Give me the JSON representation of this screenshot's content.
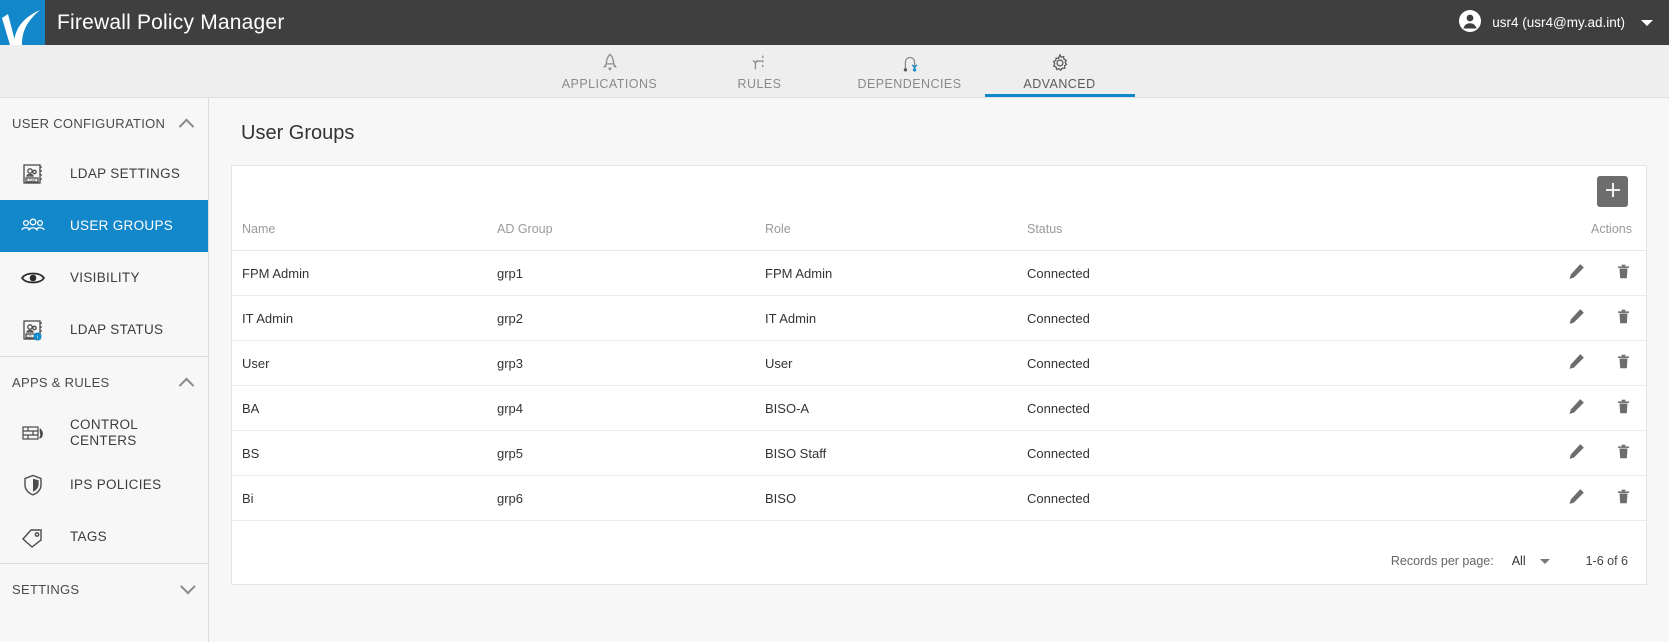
{
  "header": {
    "logo_icon": "brand-logo-icon",
    "app_title": "Firewall Policy Manager",
    "user_icon": "user-account-icon",
    "user_label": "usr4 (usr4@my.ad.int)",
    "user_menu_icon": "chevron-down-icon",
    "bg_color": "#3f3f3f",
    "logo_color": "#1288ca"
  },
  "tabs": [
    {
      "label": "APPLICATIONS",
      "icon": "rocket-icon",
      "active": false
    },
    {
      "label": "RULES",
      "icon": "rules-path-icon",
      "active": false
    },
    {
      "label": "DEPENDENCIES",
      "icon": "dependencies-arc-icon",
      "active": false
    },
    {
      "label": "ADVANCED",
      "icon": "gear-icon",
      "active": true
    }
  ],
  "accent_color": "#1288ca",
  "sidebar": {
    "sections": [
      {
        "label": "USER CONFIGURATION",
        "expanded": true,
        "chevron": "chevron-up-icon",
        "items": [
          {
            "label": "LDAP SETTINGS",
            "icon": "ldap-settings-icon",
            "active": false
          },
          {
            "label": "USER GROUPS",
            "icon": "user-groups-icon",
            "active": true
          },
          {
            "label": "VISIBILITY",
            "icon": "eye-icon",
            "active": false
          },
          {
            "label": "LDAP STATUS",
            "icon": "ldap-status-icon",
            "active": false
          }
        ]
      },
      {
        "label": "APPS & RULES",
        "expanded": true,
        "chevron": "chevron-up-icon",
        "items": [
          {
            "label": "CONTROL CENTERS",
            "icon": "control-centers-icon",
            "active": false
          },
          {
            "label": "IPS POLICIES",
            "icon": "shield-icon",
            "active": false
          },
          {
            "label": "TAGS",
            "icon": "tag-icon",
            "active": false
          }
        ]
      },
      {
        "label": "SETTINGS",
        "expanded": false,
        "chevron": "chevron-down-icon",
        "items": []
      }
    ]
  },
  "main": {
    "page_title": "User Groups",
    "add_button_icon": "plus-icon",
    "table": {
      "columns": [
        "Name",
        "AD Group",
        "Role",
        "Status",
        "Actions"
      ],
      "rows": [
        {
          "name": "FPM Admin",
          "ad_group": "grp1",
          "role": "FPM Admin",
          "status": "Connected",
          "edit_icon": "pencil-icon",
          "delete_icon": "trash-icon"
        },
        {
          "name": "IT Admin",
          "ad_group": "grp2",
          "role": "IT Admin",
          "status": "Connected",
          "edit_icon": "pencil-icon",
          "delete_icon": "trash-icon"
        },
        {
          "name": "User",
          "ad_group": "grp3",
          "role": "User",
          "status": "Connected",
          "edit_icon": "pencil-icon",
          "delete_icon": "trash-icon"
        },
        {
          "name": "BA",
          "ad_group": "grp4",
          "role": "BISO-A",
          "status": "Connected",
          "edit_icon": "pencil-icon",
          "delete_icon": "trash-icon"
        },
        {
          "name": "BS",
          "ad_group": "grp5",
          "role": "BISO Staff",
          "status": "Connected",
          "edit_icon": "pencil-icon",
          "delete_icon": "trash-icon"
        },
        {
          "name": "Bi",
          "ad_group": "grp6",
          "role": "BISO",
          "status": "Connected",
          "edit_icon": "pencil-icon",
          "delete_icon": "trash-icon"
        }
      ]
    },
    "footer": {
      "records_per_page_label": "Records per page:",
      "records_per_page_value": "All",
      "records_per_page_caret": "caret-down-icon",
      "range_text": "1-6 of 6"
    }
  }
}
